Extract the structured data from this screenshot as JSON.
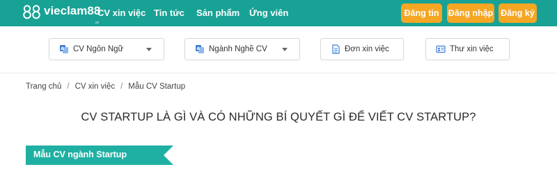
{
  "header": {
    "logo_text": "vieclam88",
    "logo_suffix": ".vn",
    "nav": [
      "CV xin việc",
      "Tin tức",
      "Sản phẩm",
      "Ứng viên"
    ],
    "buttons": {
      "post_job": "Đăng tin",
      "login": "Đăng nhập",
      "register": "Đăng ký"
    }
  },
  "filters": {
    "language": "CV Ngôn Ngữ",
    "industry": "Ngành Nghề CV",
    "application": "Đơn xin việc",
    "cover_letter": "Thư xin việc"
  },
  "breadcrumb": [
    "Trang chủ",
    "CV xin việc",
    "Mẫu CV Startup"
  ],
  "page_title": "CV STARTUP LÀ GÌ VÀ CÓ NHỮNG BÍ QUYẾT GÌ ĐỂ VIẾT CV STARTUP?",
  "section_banner": "Mẫu CV ngành Startup",
  "colors": {
    "brand_teal": "#18a295",
    "button_orange": "#f5a623",
    "banner_teal": "#1fb0a3",
    "icon_blue": "#3b7dd8"
  }
}
